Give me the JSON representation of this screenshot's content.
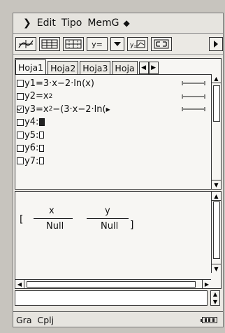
{
  "menu": {
    "caret_icon": "down-chevron-icon",
    "items": [
      "Edit",
      "Tipo",
      "MemG"
    ],
    "diamond_icon": "diamond-icon"
  },
  "toolbar": {
    "buttons": [
      {
        "icon": "graph-icon"
      },
      {
        "icon": "table-icon"
      },
      {
        "icon": "grid-icon"
      },
      {
        "label": "y="
      },
      {
        "icon": "dropdown-arrow-icon"
      },
      {
        "icon": "graph-type-icon"
      },
      {
        "icon": "resize-icon"
      },
      {
        "icon": "right-arrow-icon"
      }
    ]
  },
  "editor": {
    "tabs": [
      "Hoja1",
      "Hoja2",
      "Hoja3",
      "Hoja"
    ],
    "active_tab": "Hoja1",
    "equations": [
      {
        "label": "y1=",
        "expr": "3·x−2·ln(x)",
        "checked": false,
        "has_style": true
      },
      {
        "label": "y2=",
        "expr": "x",
        "sup": "2",
        "checked": false,
        "has_style": true
      },
      {
        "label": "y3=",
        "expr": "x",
        "sup": "2",
        "tail": "−(3·x−2·ln(",
        "checked": true,
        "has_style": true
      },
      {
        "label": "y4:",
        "expr": "",
        "checked": false,
        "cursor": true
      },
      {
        "label": "y5:",
        "expr": "",
        "checked": false
      },
      {
        "label": "y6:",
        "expr": "",
        "checked": false
      },
      {
        "label": "y7:",
        "expr": "",
        "checked": false
      }
    ]
  },
  "table": {
    "headers": [
      "x",
      "y"
    ],
    "values": [
      "Null",
      "Null"
    ]
  },
  "status": {
    "left": "Gra",
    "middle": "Cplj",
    "battery": "battery-icon"
  }
}
